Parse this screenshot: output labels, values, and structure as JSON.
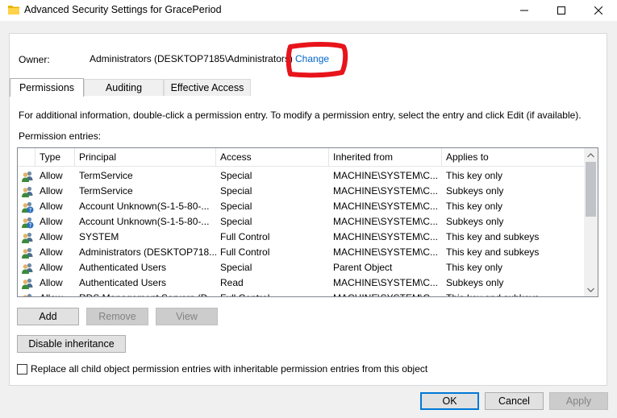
{
  "window": {
    "title": "Advanced Security Settings for GracePeriod",
    "minimize": "—",
    "maximize": "☐",
    "close": "✕"
  },
  "owner": {
    "label": "Owner:",
    "value": "Administrators (DESKTOP7185\\Administrators)",
    "change_link": "Change"
  },
  "tabs": [
    {
      "label": "Permissions",
      "active": true
    },
    {
      "label": "Auditing",
      "active": false
    },
    {
      "label": "Effective Access",
      "active": false
    }
  ],
  "info_text": "For additional information, double-click a permission entry. To modify a permission entry, select the entry and click Edit (if available).",
  "entries_label": "Permission entries:",
  "table": {
    "columns": [
      "Type",
      "Principal",
      "Access",
      "Inherited from",
      "Applies to"
    ],
    "rows": [
      {
        "icon": "group-icon",
        "type": "Allow",
        "principal": "TermService",
        "access": "Special",
        "inherited": "MACHINE\\SYSTEM\\C...",
        "applies": "This key only"
      },
      {
        "icon": "group-icon",
        "type": "Allow",
        "principal": "TermService",
        "access": "Special",
        "inherited": "MACHINE\\SYSTEM\\C...",
        "applies": "Subkeys only"
      },
      {
        "icon": "unknown-user-icon",
        "type": "Allow",
        "principal": "Account Unknown(S-1-5-80-...",
        "access": "Special",
        "inherited": "MACHINE\\SYSTEM\\C...",
        "applies": "This key only"
      },
      {
        "icon": "unknown-user-icon",
        "type": "Allow",
        "principal": "Account Unknown(S-1-5-80-...",
        "access": "Special",
        "inherited": "MACHINE\\SYSTEM\\C...",
        "applies": "Subkeys only"
      },
      {
        "icon": "group-icon",
        "type": "Allow",
        "principal": "SYSTEM",
        "access": "Full Control",
        "inherited": "MACHINE\\SYSTEM\\C...",
        "applies": "This key and subkeys"
      },
      {
        "icon": "group-icon",
        "type": "Allow",
        "principal": "Administrators (DESKTOP718...",
        "access": "Full Control",
        "inherited": "MACHINE\\SYSTEM\\C...",
        "applies": "This key and subkeys"
      },
      {
        "icon": "group-icon",
        "type": "Allow",
        "principal": "Authenticated Users",
        "access": "Special",
        "inherited": "Parent Object",
        "applies": "This key only"
      },
      {
        "icon": "group-icon",
        "type": "Allow",
        "principal": "Authenticated Users",
        "access": "Read",
        "inherited": "MACHINE\\SYSTEM\\C...",
        "applies": "Subkeys only"
      },
      {
        "icon": "group-icon",
        "type": "Allow",
        "principal": "RDS Management Servers (D...",
        "access": "Full Control",
        "inherited": "MACHINE\\SYSTEM\\C...",
        "applies": "This key and subkeys"
      }
    ]
  },
  "buttons": {
    "add": "Add",
    "remove": "Remove",
    "view": "View",
    "disable_inheritance": "Disable inheritance",
    "ok": "OK",
    "cancel": "Cancel",
    "apply": "Apply"
  },
  "replace_checkbox": {
    "label": "Replace all child object permission entries with inheritable permission entries from this object",
    "checked": false
  },
  "colors": {
    "link": "#0066cc",
    "annotation": "#e8141c",
    "default_button_border": "#0078d7"
  }
}
